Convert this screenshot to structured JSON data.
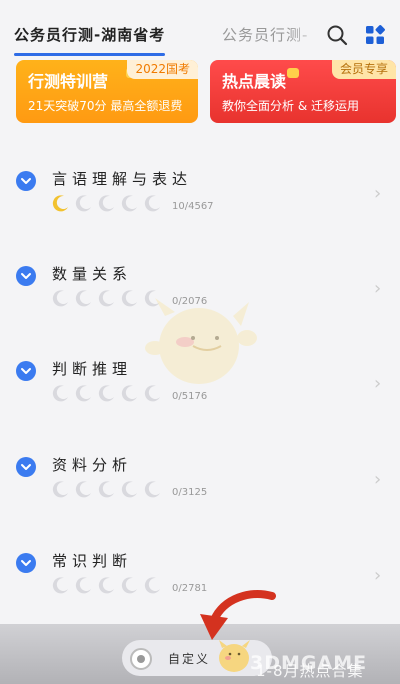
{
  "header": {
    "active_tab": "公务员行测-湖南省考",
    "inactive_tab": "公务员行测-"
  },
  "banners": {
    "left": {
      "title": "行测特训营",
      "tag": "2022国考",
      "subtitle": "21天突破70分 最高全额退费"
    },
    "right": {
      "title": "热点晨读",
      "tag": "会员专享",
      "subtitle": "教你全面分析 & 迁移运用"
    }
  },
  "chapters": [
    {
      "title": "言语理解与表达",
      "progress": "10/4567",
      "filled_moons": 1
    },
    {
      "title": "数量关系",
      "progress": "0/2076",
      "filled_moons": 0
    },
    {
      "title": "判断推理",
      "progress": "0/5176",
      "filled_moons": 0
    },
    {
      "title": "资料分析",
      "progress": "0/3125",
      "filled_moons": 0
    },
    {
      "title": "常识判断",
      "progress": "0/2781",
      "filled_moons": 0
    }
  ],
  "bottom": {
    "custom_label": "自定义",
    "promo_text": "1-8月热点合集",
    "watermark": "3DMGAME"
  },
  "colors": {
    "accent_blue": "#3b7bf0",
    "banner_orange": "#ffa515",
    "banner_red": "#ee3b36",
    "moon_filled": "#f2c230",
    "moon_empty": "#d9d9de",
    "arrow_red": "#d4321f"
  },
  "icons": {
    "search": "search-icon",
    "grid": "grid-menu-icon",
    "chevron": "chevron-down-icon",
    "moon": "moon-icon",
    "arrow": "chevron-right-icon"
  }
}
